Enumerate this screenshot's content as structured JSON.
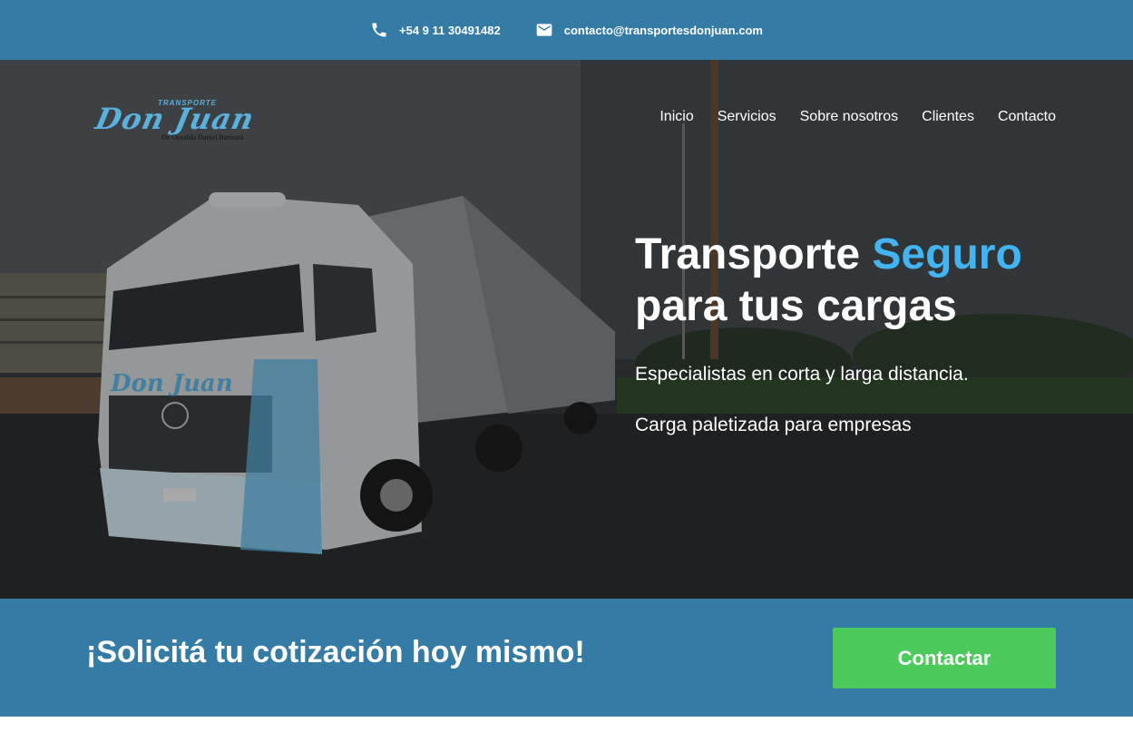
{
  "topbar": {
    "phone": "+54 9 11 30491482",
    "email": "contacto@transportesdonjuan.com",
    "phone_icon": "phone-icon",
    "email_icon": "mail-icon"
  },
  "logo": {
    "small": "TRANSPORTE",
    "name": "Don Juan",
    "subtitle": "De Osvaldo Daniel Barisoni"
  },
  "nav": {
    "items": [
      "Inicio",
      "Servicios",
      "Sobre nosotros",
      "Clientes",
      "Contacto"
    ]
  },
  "hero": {
    "headline_part1": "Transporte ",
    "headline_accent": "Seguro",
    "headline_part2": "para tus cargas",
    "line1": "Especialistas en corta y larga distancia.",
    "line2": "Carga paletizada para empresas"
  },
  "cta": {
    "text": "¡Solicitá tu cotización hoy mismo!",
    "button": "Contactar"
  },
  "colors": {
    "primary": "#347ca6",
    "accent": "#42b4f2",
    "button": "#4cca5b"
  }
}
